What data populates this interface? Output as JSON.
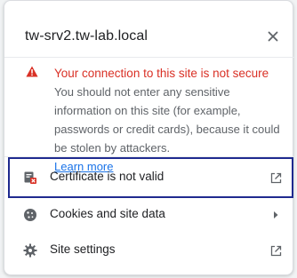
{
  "popup": {
    "site_title": "tw-srv2.tw-lab.local",
    "close_glyph": "×"
  },
  "warning": {
    "icon": "warning-triangle-icon",
    "title": "Your connection to this site is not secure",
    "body": "You should not enter any sensitive information on this site (for example, passwords or credit cards), because it could be stolen by attackers.",
    "link": "Learn more"
  },
  "rows": [
    {
      "label": "Certificate is not valid",
      "icon": "certificate-icon",
      "end_icon": "external-link-icon"
    },
    {
      "label": "Cookies and site data",
      "icon": "cookie-icon",
      "end_icon": "chevron-right-icon"
    },
    {
      "label": "Site settings",
      "icon": "gear-icon",
      "end_icon": "external-link-icon"
    }
  ],
  "colors": {
    "danger": "#d93025",
    "link": "#1a73e8",
    "highlight_border": "#1f2a8f"
  }
}
